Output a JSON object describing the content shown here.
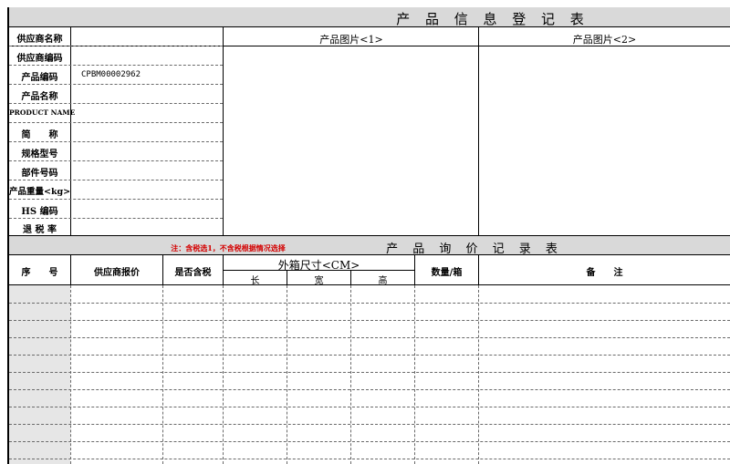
{
  "product_info": {
    "title": "产 品 信 息 登 记 表",
    "fields": [
      {
        "label": "供应商名称",
        "value": ""
      },
      {
        "label": "供应商编码",
        "value": ""
      },
      {
        "label": "产品编码",
        "value": "CPBM00002962"
      },
      {
        "label": "产品名称",
        "value": ""
      },
      {
        "label": "PRODUCT NAME",
        "value": ""
      },
      {
        "label": "简　　称",
        "value": ""
      },
      {
        "label": "规格型号",
        "value": ""
      },
      {
        "label": "部件号码",
        "value": ""
      },
      {
        "label": "产品重量<kg>",
        "value": ""
      },
      {
        "label": "HS 编码",
        "value": ""
      },
      {
        "label": "退 税 率",
        "value": ""
      }
    ],
    "picture_headers": [
      "产品图片<1>",
      "产品图片<2>"
    ]
  },
  "inquiry": {
    "title": "产 品 询 价 记 录 表",
    "note": "注：含税选1，不含税根据情况选择",
    "headers": {
      "seq": "序　　号",
      "supplier_price": "供应商报价",
      "tax_included": "是否含税",
      "carton_size": "外箱尺寸<CM>",
      "length": "长",
      "width": "宽",
      "height": "高",
      "qty_per_carton": "数量/箱",
      "remarks": "备　　注"
    }
  },
  "colors": {
    "header_band": "#d9d9d9",
    "note": "#d40000",
    "first_column": "#e6e6e6"
  }
}
